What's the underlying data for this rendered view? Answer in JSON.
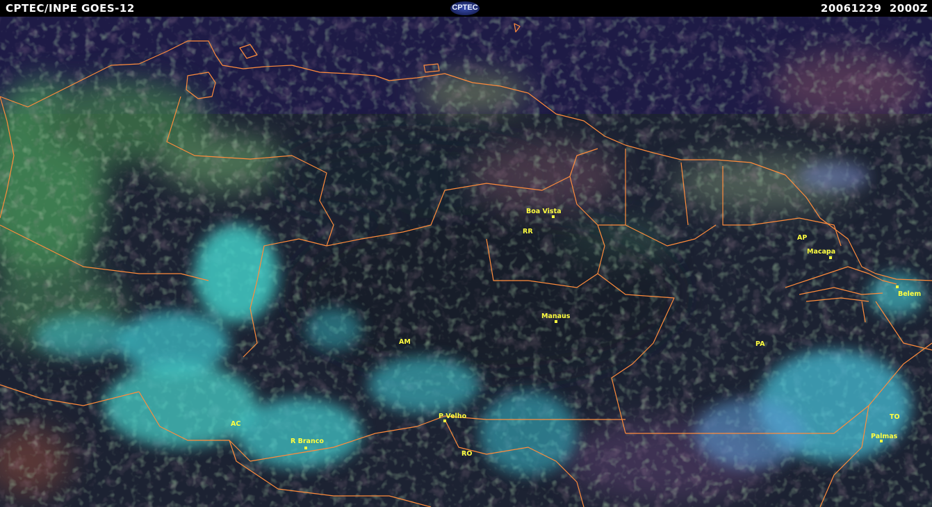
{
  "header": {
    "source_label": "CPTEC/INPE  GOES-12",
    "logo_text": "CPTEC",
    "datetime": "20061229  2000Z"
  },
  "colors": {
    "background": "#1b1a3a",
    "ocean": "#1e1b46",
    "border_lines": "#ff8c3c",
    "labels": "#ffff40",
    "cloud_high": "#46e6dc",
    "vegetation": "#50b46e"
  },
  "labels": {
    "states": {
      "rr": "RR",
      "ap": "AP",
      "am": "AM",
      "pa": "PA",
      "ac": "AC",
      "ro": "RO",
      "to": "TO"
    },
    "cities": {
      "boa_vista": "Boa Vista",
      "macapa": "Macapa",
      "belem": "Belem",
      "manaus": "Manaus",
      "porto_velho": "P Velho",
      "rio_branco": "R Branco",
      "palmas": "Palmas"
    }
  }
}
